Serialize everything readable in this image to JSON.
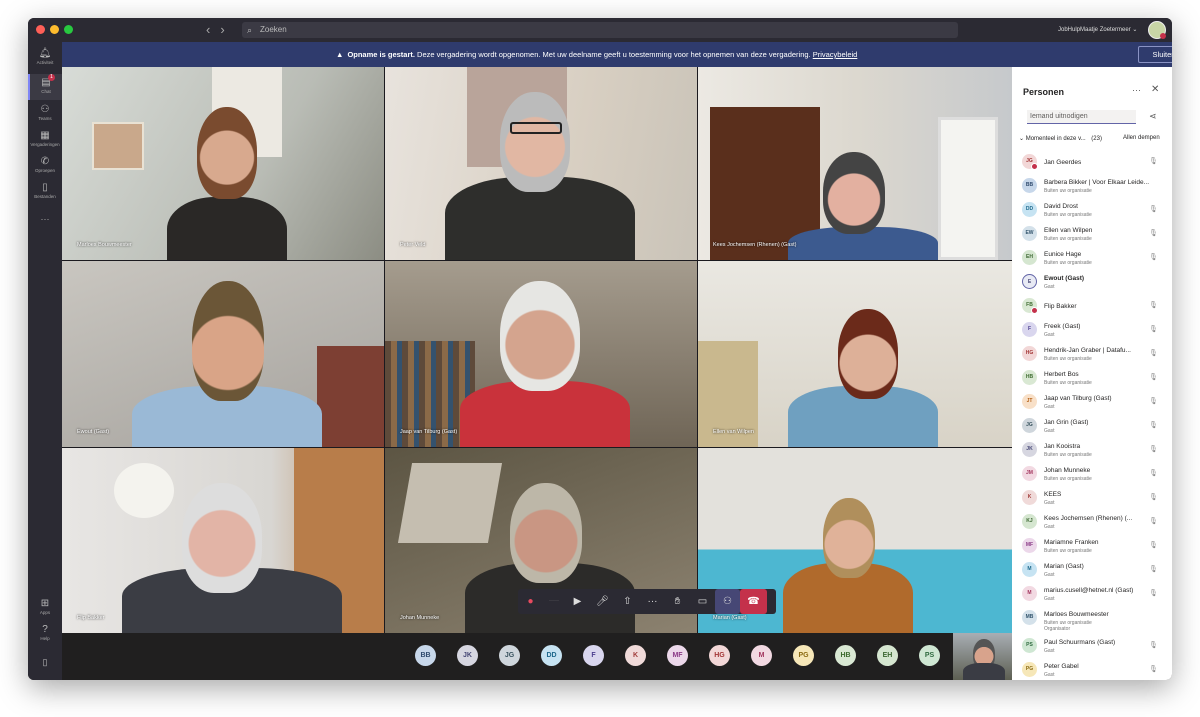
{
  "titlebar": {
    "search_placeholder": "Zoeken",
    "org_name": "JobHulpMaatje Zoetermeer ⌄"
  },
  "rail": {
    "items": [
      {
        "label": "Activiteit",
        "icon": "bell-icon"
      },
      {
        "label": "Chat",
        "icon": "chat-icon",
        "badge": "1"
      },
      {
        "label": "Teams",
        "icon": "teams-icon"
      },
      {
        "label": "Vergaderingen",
        "icon": "calendar-icon"
      },
      {
        "label": "Oproepen",
        "icon": "phone-icon"
      },
      {
        "label": "Bestanden",
        "icon": "file-icon"
      },
      {
        "label": "Apps",
        "icon": "apps-icon"
      },
      {
        "label": "Help",
        "icon": "help-icon"
      }
    ]
  },
  "banner": {
    "bold": "Opname is gestart.",
    "text": " Deze vergadering wordt opgenomen. Met uw deelname geeft u toestemming voor het opnemen van deze vergadering. ",
    "link": "Privacybeleid",
    "close": "Sluiten"
  },
  "tiles": [
    {
      "name": "Marloes Bouwmeester"
    },
    {
      "name": "Peter Veld"
    },
    {
      "name": "Kees Jochemsen (Rhenen) (Gast)"
    },
    {
      "name": "Ewout (Gast)"
    },
    {
      "name": "Jaap van Tilburg (Gast)"
    },
    {
      "name": "Ellen van Wilpen"
    },
    {
      "name": "Flip Bakker"
    },
    {
      "name": "Johan Munneke"
    },
    {
      "name": "Marian (Gast)"
    }
  ],
  "strip": [
    "BB",
    "JK",
    "JG",
    "DD",
    "F",
    "K",
    "MF",
    "HG",
    "M",
    "PG",
    "HB",
    "EH",
    "PS"
  ],
  "panel": {
    "title": "Personen",
    "invite_placeholder": "Iemand uitnodigen",
    "section": "Momenteel in deze v...",
    "count": "(23)",
    "mute_all": "Allen dempen",
    "people": [
      {
        "initials": "JG",
        "name": "Jan Geerdes",
        "sub": ""
      },
      {
        "initials": "BB",
        "name": "Barbera Bikker | Voor Elkaar Leide...",
        "sub": "Buiten uw organisatie"
      },
      {
        "initials": "DD",
        "name": "David Drost",
        "sub": "Buiten uw organisatie"
      },
      {
        "initials": "EW",
        "name": "Ellen van Wilpen",
        "sub": "Buiten uw organisatie"
      },
      {
        "initials": "EH",
        "name": "Eunice Hage",
        "sub": "Buiten uw organisatie"
      },
      {
        "initials": "E",
        "name": "Ewout (Gast)",
        "sub": "Gast"
      },
      {
        "initials": "FB",
        "name": "Flip Bakker",
        "sub": ""
      },
      {
        "initials": "F",
        "name": "Freek (Gast)",
        "sub": "Gast"
      },
      {
        "initials": "HG",
        "name": "Hendrik-Jan Graber | Datafu...",
        "sub": "Buiten uw organisatie"
      },
      {
        "initials": "HB",
        "name": "Herbert Bos",
        "sub": "Buiten uw organisatie"
      },
      {
        "initials": "JT",
        "name": "Jaap van Tilburg (Gast)",
        "sub": "Gast"
      },
      {
        "initials": "JG",
        "name": "Jan Grin (Gast)",
        "sub": "Gast"
      },
      {
        "initials": "JK",
        "name": "Jan Kooistra",
        "sub": "Buiten uw organisatie"
      },
      {
        "initials": "JM",
        "name": "Johan Munneke",
        "sub": "Buiten uw organisatie"
      },
      {
        "initials": "K",
        "name": "KEES",
        "sub": "Gast"
      },
      {
        "initials": "KJ",
        "name": "Kees Jochemsen (Rhenen) (...",
        "sub": "Gast"
      },
      {
        "initials": "MF",
        "name": "Mariamne Franken",
        "sub": "Buiten uw organisatie"
      },
      {
        "initials": "M",
        "name": "Marian (Gast)",
        "sub": "Gast"
      },
      {
        "initials": "M",
        "name": "marius.cusell@hetnet.nl (Gast)",
        "sub": "Gast"
      },
      {
        "initials": "MB",
        "name": "Marloes Bouwmeester",
        "sub": "Buiten uw organisatie"
      },
      {
        "initials": "PS",
        "name": "Paul Schuurmans (Gast)",
        "sub": "Gast"
      },
      {
        "initials": "PG",
        "name": "Peter Gabel",
        "sub": "Gast"
      }
    ]
  },
  "organisator_label": "Organisator",
  "colors": {
    "accent": "#6264a7",
    "banner": "#2f3b6d",
    "hangup": "#c4314b"
  }
}
